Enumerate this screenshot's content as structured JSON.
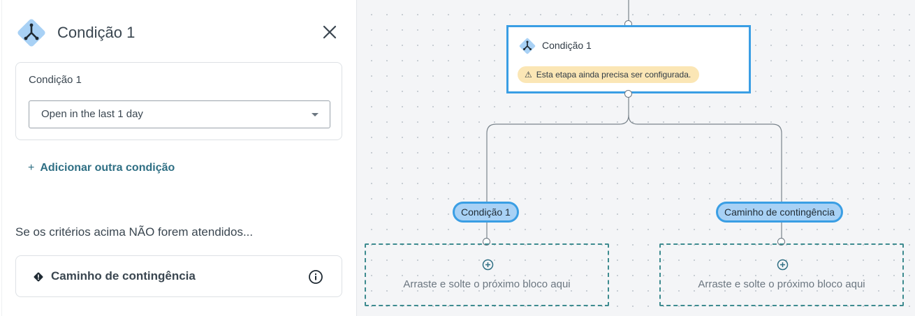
{
  "panel": {
    "title": "Condição 1",
    "condition_card": {
      "label": "Condição 1",
      "select_value": "Open in the last 1 day"
    },
    "add_condition": {
      "plus": "+",
      "label": "Adicionar outra condição"
    },
    "fallback_text": "Se os critérios acima NÃO forem atendidos...",
    "fallback_card": {
      "label": "Caminho de contingência"
    }
  },
  "canvas": {
    "node": {
      "title": "Condição 1",
      "warning": "Esta etapa ainda precisa ser configurada."
    },
    "branches": {
      "left": "Condição 1",
      "right": "Caminho de contingência"
    },
    "dropzones": {
      "left": "Arraste e solte o próximo bloco aqui",
      "right": "Arraste e solte o próximo bloco aqui"
    }
  },
  "colors": {
    "accent": "#3a9ee4",
    "link": "#2f6f84",
    "warning_bg": "#fbe6b5",
    "pill_bg": "#a8d1f5",
    "dropzone_border": "#3d8b8f"
  }
}
